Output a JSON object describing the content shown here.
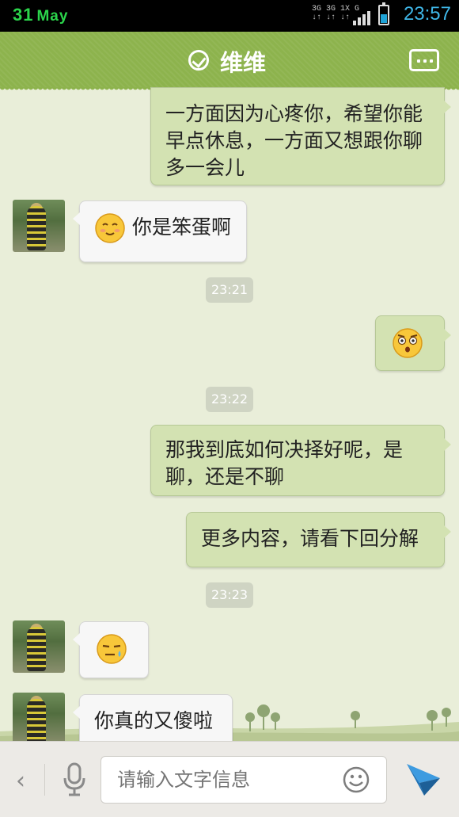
{
  "status_bar": {
    "date_day": "31",
    "date_month": "May",
    "network_line1": "3G 3G 1X G",
    "network_line2": "↓↑ ↓↑ ↓↑",
    "time": "23:57",
    "battery_level": 0.55
  },
  "header": {
    "title": "维维"
  },
  "messages": [
    {
      "side": "out",
      "text": "一方面因为心疼你，希望你能早点休息，一方面又想跟你聊多一会儿"
    },
    {
      "side": "in",
      "emoji": "blush-face",
      "text": "你是笨蛋啊"
    },
    {
      "type": "timestamp",
      "text": "23:21"
    },
    {
      "side": "out",
      "emoji": "shocked-face",
      "text": ""
    },
    {
      "type": "timestamp",
      "text": "23:22"
    },
    {
      "side": "out",
      "text": "那我到底如何决择好呢，是聊，还是不聊"
    },
    {
      "side": "out",
      "text": "更多内容，请看下回分解"
    },
    {
      "type": "timestamp",
      "text": "23:23"
    },
    {
      "side": "in",
      "emoji": "sweat-face",
      "text": ""
    },
    {
      "side": "in",
      "text": "你真的又傻啦"
    }
  ],
  "input_bar": {
    "placeholder": "请输入文字信息"
  },
  "colors": {
    "header_green": "#8db34d",
    "out_bubble": "#d3e2b2",
    "in_bubble": "#f7f7f7",
    "status_time": "#3fb7e8",
    "status_date": "#2bd44b",
    "send_blue": "#2b8fd6"
  }
}
